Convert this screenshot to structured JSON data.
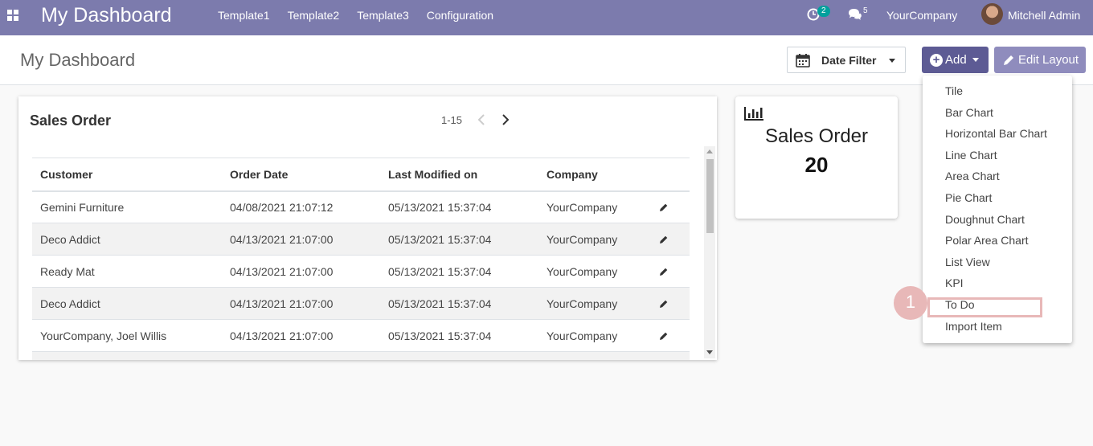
{
  "navbar": {
    "brand": "My Dashboard",
    "menu": [
      "Template1",
      "Template2",
      "Template3",
      "Configuration"
    ],
    "activity_count": "2",
    "message_count": "5",
    "company": "YourCompany",
    "user": "Mitchell Admin"
  },
  "control": {
    "title": "My Dashboard",
    "date_filter_label": "Date Filter",
    "add_label": "Add",
    "edit_layout_label": "Edit Layout"
  },
  "list_card": {
    "title": "Sales Order",
    "pager": "1-15",
    "columns": [
      "Customer",
      "Order Date",
      "Last Modified on",
      "Company"
    ],
    "rows": [
      [
        "Gemini Furniture",
        "04/08/2021 21:07:12",
        "05/13/2021 15:37:04",
        "YourCompany"
      ],
      [
        "Deco Addict",
        "04/13/2021 21:07:00",
        "05/13/2021 15:37:04",
        "YourCompany"
      ],
      [
        "Ready Mat",
        "04/13/2021 21:07:00",
        "05/13/2021 15:37:04",
        "YourCompany"
      ],
      [
        "Deco Addict",
        "04/13/2021 21:07:00",
        "05/13/2021 15:37:04",
        "YourCompany"
      ],
      [
        "YourCompany, Joel Willis",
        "04/13/2021 21:07:00",
        "05/13/2021 15:37:04",
        "YourCompany"
      ]
    ]
  },
  "tile_card": {
    "title": "Sales Order",
    "value": "20",
    "icon": "bar-chart-icon"
  },
  "add_menu": {
    "items": [
      "Tile",
      "Bar Chart",
      "Horizontal Bar Chart",
      "Line Chart",
      "Area Chart",
      "Pie Chart",
      "Doughnut Chart",
      "Polar Area Chart",
      "List View",
      "KPI",
      "To Do",
      "Import Item"
    ],
    "highlighted": "To Do"
  },
  "annotation": {
    "step": "1"
  },
  "colors": {
    "navbar": "#7c7bad",
    "add_button": "#5d5b94",
    "edit_button": "#8f8cbd",
    "annotation": "#e8b8b8",
    "activity_badge": "#00a09d"
  }
}
